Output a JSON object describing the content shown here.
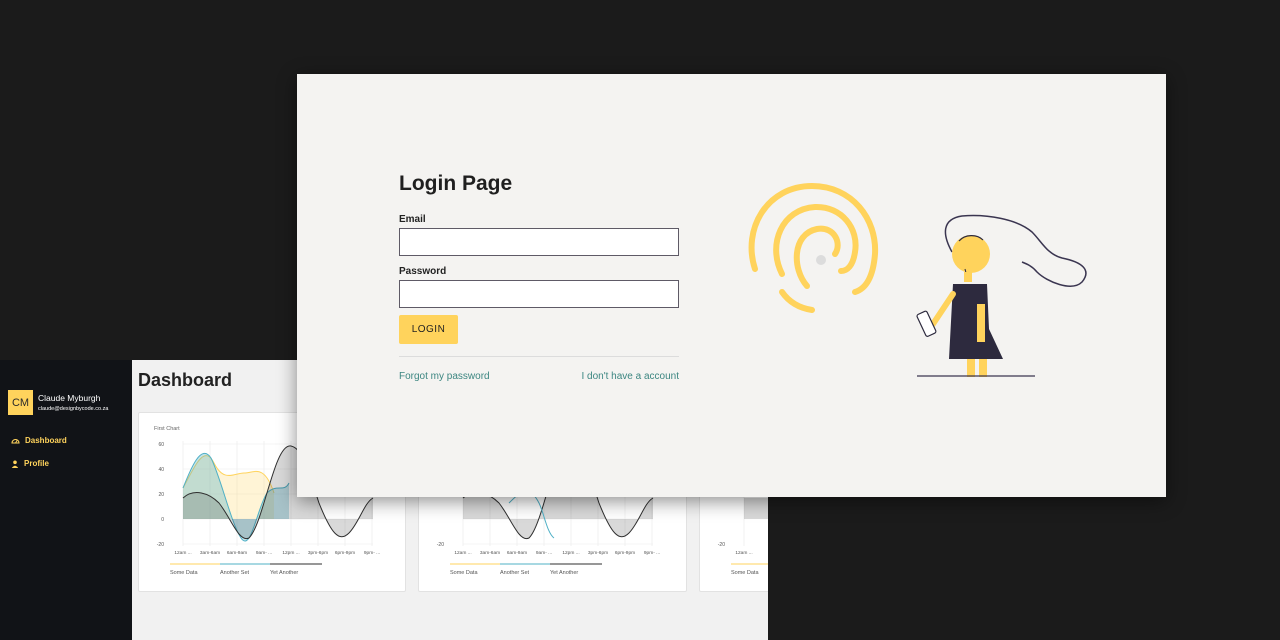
{
  "dashboard": {
    "title": "Dashboard",
    "user": {
      "initials": "CM",
      "name": "Claude Myburgh",
      "email": "claude@designbycode.co.za"
    },
    "nav": [
      {
        "label": "Dashboard",
        "icon": "dashboard-gauge-icon"
      },
      {
        "label": "Profile",
        "icon": "user-icon"
      }
    ],
    "colors": {
      "accent": "#ffd35c",
      "sidebar": "#111317",
      "series": [
        "#ffd35c",
        "#4fb0c6",
        "#2f2f2f"
      ]
    },
    "chart_card": {
      "title": "First Chart",
      "y_ticks": [
        "60",
        "40",
        "20",
        "0",
        "-20"
      ],
      "x_ticks": [
        "12am ...",
        "3am-6am",
        "6am-9am",
        "9am- ...",
        "12pm ...",
        "3pm-6pm",
        "6pm-9pm",
        "9pm- ..."
      ],
      "legend": [
        "Some Data",
        "Another Set",
        "Yet Another"
      ]
    }
  },
  "login": {
    "title": "Login Page",
    "email_label": "Email",
    "email_value": "",
    "password_label": "Password",
    "password_value": "",
    "button_label": "LOGIN",
    "forgot_link": "Forgot my password",
    "register_link": "I don't have a account",
    "colors": {
      "accent": "#ffd35c",
      "link": "#3c8681",
      "background": "#f4f3f1"
    }
  }
}
